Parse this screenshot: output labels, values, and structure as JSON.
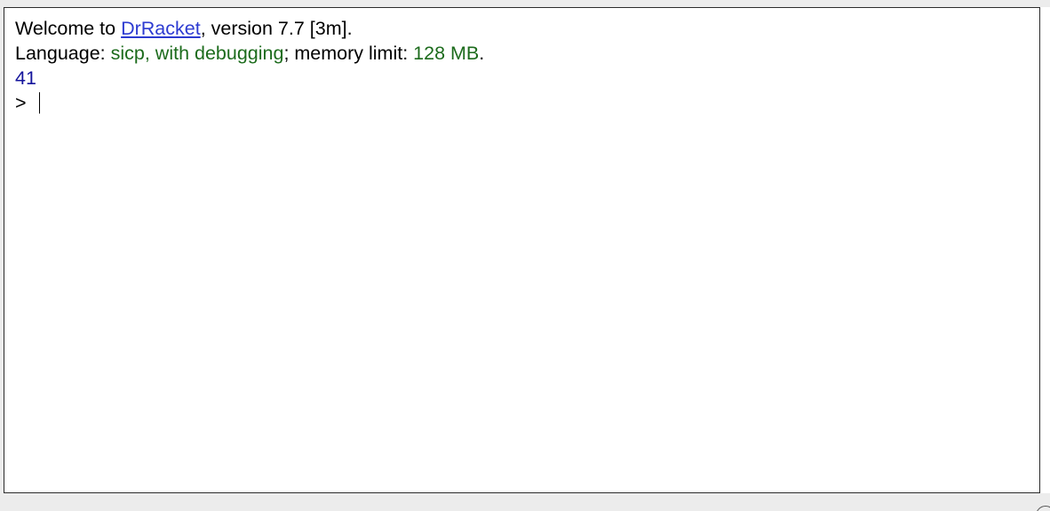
{
  "repl": {
    "welcome_prefix": "Welcome to ",
    "welcome_link": "DrRacket",
    "welcome_suffix": ", version 7.7 [3m].",
    "language_label": "Language: ",
    "language_value": "sicp, with debugging",
    "memory_label": "; memory limit: ",
    "memory_value": "128 MB",
    "memory_suffix": ".",
    "result": "41",
    "prompt": ">"
  },
  "colors": {
    "link": "#2d3bd1",
    "language_green": "#1c6b1c",
    "result_blue": "#14149c"
  }
}
